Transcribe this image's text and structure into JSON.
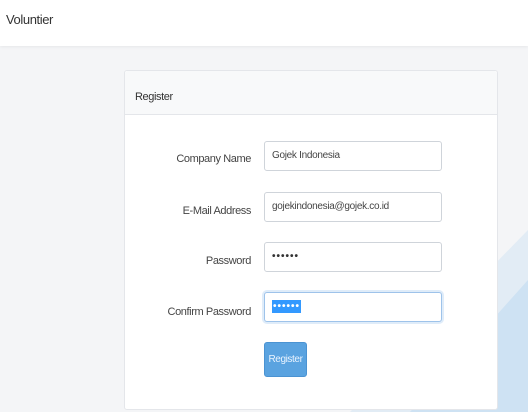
{
  "app": {
    "brand": "Voluntier"
  },
  "register": {
    "title": "Register",
    "fields": [
      {
        "label": "Company Name",
        "value": "Gojek Indonesia"
      },
      {
        "label": "E-Mail Address",
        "value": "gojekindonesia@gojek.co.id"
      },
      {
        "label": "Password",
        "value": "••••••"
      },
      {
        "label": "Confirm Password",
        "value": "••••••"
      }
    ],
    "submit_label": "Register"
  },
  "colors": {
    "accent": "#5aa3e0",
    "decoration": "#1e88e5",
    "background": "#f4f5f7"
  }
}
